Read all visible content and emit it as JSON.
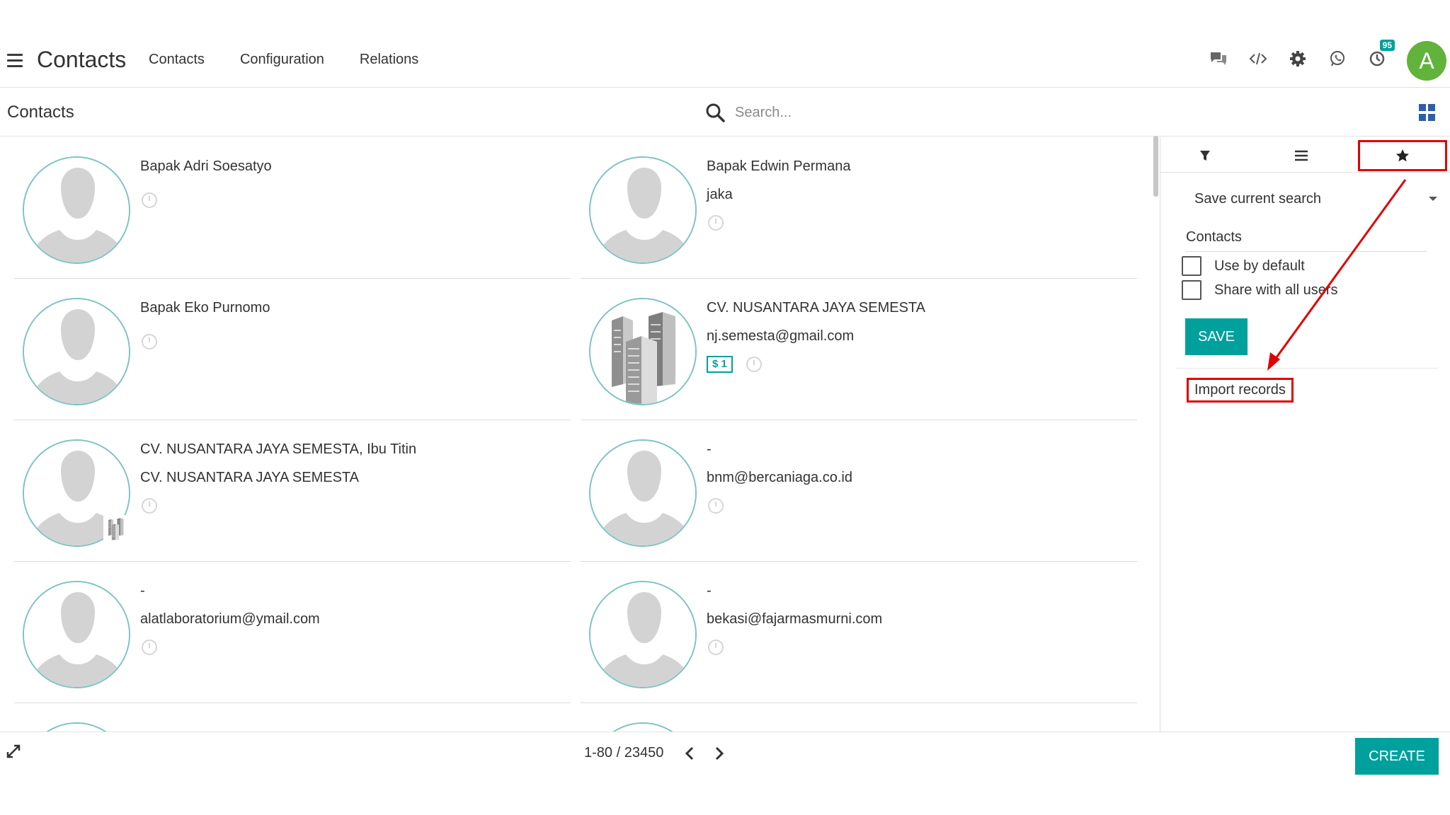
{
  "navbar": {
    "app_title": "Contacts",
    "menu": [
      "Contacts",
      "Configuration",
      "Relations"
    ],
    "activity_badge": "95",
    "user_initial": "A",
    "user_color": "#61b33b"
  },
  "control_panel": {
    "breadcrumb": "Contacts",
    "search_placeholder": "Search..."
  },
  "contacts": [
    {
      "name": "Bapak Adri Soesatyo",
      "line2": ""
    },
    {
      "name": "Bapak Edwin Permana",
      "line2": "jaka"
    },
    {
      "name": "Bapak Eko Purnomo",
      "line2": ""
    },
    {
      "name": "CV. NUSANTARA JAYA SEMESTA",
      "line2": "nj.semesta@gmail.com",
      "tag": "$ 1"
    },
    {
      "name": "CV. NUSANTARA JAYA SEMESTA, Ibu Titin",
      "line2": "CV. NUSANTARA JAYA SEMESTA"
    },
    {
      "name": "-",
      "line2": "bnm@bercaniaga.co.id"
    },
    {
      "name": "-",
      "line2": "alatlaboratorium@ymail.com"
    },
    {
      "name": "-",
      "line2": "bekasi@fajarmasmurni.com"
    }
  ],
  "favorites_panel": {
    "save_current_search": "Save current search",
    "favorite_name": "Contacts",
    "use_by_default": "Use by default",
    "share_with_all": "Share with all users",
    "save_label": "SAVE",
    "import_records": "Import records"
  },
  "footer": {
    "pager": "1-80 / 23450",
    "create_label": "CREATE"
  },
  "colors": {
    "primary": "#00a09d",
    "highlight": "#e00000"
  }
}
